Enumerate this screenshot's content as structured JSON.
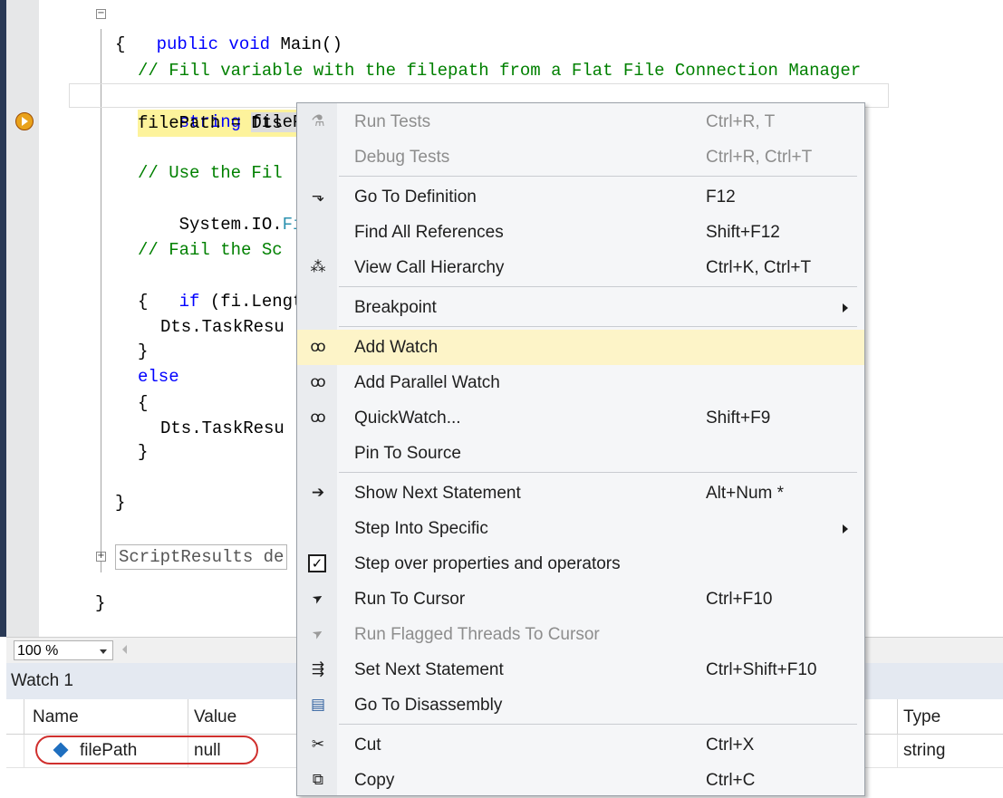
{
  "editor": {
    "lines": [
      {
        "id": "l1",
        "tokens": [
          {
            "t": "public void ",
            "c": "kw"
          },
          {
            "t": "Main()",
            "c": ""
          }
        ]
      },
      {
        "id": "l2",
        "tokens": [
          {
            "t": "{",
            "c": ""
          }
        ]
      },
      {
        "id": "l3",
        "tokens": [
          {
            "t": "// Fill variable with the filepath from a Flat File Connection Manager",
            "c": "cm"
          }
        ]
      },
      {
        "id": "l4",
        "tokens": [
          {
            "t": "string ",
            "c": "kw"
          },
          {
            "t": "filePath",
            "c": "ref"
          },
          {
            "t": ";",
            "c": ""
          }
        ]
      },
      {
        "id": "l5",
        "tokens": [
          {
            "t": "filePath = Dts",
            "c": ""
          }
        ]
      },
      {
        "id": "l6",
        "tokens": [
          {
            "t": "// Use the Fil",
            "c": "cm"
          }
        ]
      },
      {
        "id": "l7",
        "tokens": [
          {
            "t": "System.IO.",
            "c": ""
          },
          {
            "t": "File",
            "c": "tp"
          }
        ]
      },
      {
        "id": "l8",
        "tokens": [
          {
            "t": "// Fail the Sc",
            "c": "cm"
          }
        ]
      },
      {
        "id": "l9",
        "tokens": [
          {
            "t": "if ",
            "c": "kw"
          },
          {
            "t": "(fi.Length",
            "c": ""
          }
        ]
      },
      {
        "id": "l10",
        "tokens": [
          {
            "t": "{",
            "c": ""
          }
        ]
      },
      {
        "id": "l11",
        "tokens": [
          {
            "t": "Dts.TaskResu",
            "c": ""
          }
        ]
      },
      {
        "id": "l12",
        "tokens": [
          {
            "t": "}",
            "c": ""
          }
        ]
      },
      {
        "id": "l13",
        "tokens": [
          {
            "t": "else",
            "c": "kw"
          }
        ]
      },
      {
        "id": "l14",
        "tokens": [
          {
            "t": "{",
            "c": ""
          }
        ]
      },
      {
        "id": "l15",
        "tokens": [
          {
            "t": "Dts.TaskResu",
            "c": ""
          }
        ]
      },
      {
        "id": "l16",
        "tokens": [
          {
            "t": "}",
            "c": ""
          }
        ]
      },
      {
        "id": "l17",
        "tokens": [
          {
            "t": "}",
            "c": ""
          }
        ]
      },
      {
        "id": "l18",
        "tokens": [
          {
            "t": "ScriptResults de",
            "c": ""
          }
        ]
      },
      {
        "id": "l19",
        "tokens": [
          {
            "t": "}",
            "c": ""
          }
        ]
      }
    ],
    "fold_minus": "−",
    "fold_plus": "+"
  },
  "zoom": {
    "value": "100 %"
  },
  "watch": {
    "title": "Watch 1",
    "columns": {
      "name": "Name",
      "value": "Value",
      "type": "Type"
    },
    "rows": [
      {
        "name": "filePath",
        "value": "null",
        "type": "string"
      }
    ]
  },
  "context_menu": {
    "items": [
      {
        "id": "run-tests",
        "label": "Run Tests",
        "shortcut": "Ctrl+R, T",
        "icon": "flask-icon",
        "glyph": "⚗",
        "disabled": true
      },
      {
        "id": "debug-tests",
        "label": "Debug Tests",
        "shortcut": "Ctrl+R, Ctrl+T",
        "icon": "",
        "glyph": "",
        "disabled": true
      },
      {
        "id": "go-to-definition",
        "label": "Go To Definition",
        "shortcut": "F12",
        "icon": "go-to-definition-icon",
        "glyph": "⬎",
        "disabled": false
      },
      {
        "id": "find-all-references",
        "label": "Find All References",
        "shortcut": "Shift+F12",
        "icon": "",
        "glyph": "",
        "disabled": false
      },
      {
        "id": "view-call-hierarchy",
        "label": "View Call Hierarchy",
        "shortcut": "Ctrl+K, Ctrl+T",
        "icon": "call-hierarchy-icon",
        "glyph": "⁂",
        "disabled": false
      },
      {
        "id": "breakpoint",
        "label": "Breakpoint",
        "shortcut": "",
        "icon": "",
        "glyph": "",
        "disabled": false,
        "submenu": true
      },
      {
        "id": "add-watch",
        "label": "Add Watch",
        "shortcut": "",
        "icon": "glasses-icon",
        "glyph": "👓",
        "disabled": false
      },
      {
        "id": "add-parallel-watch",
        "label": "Add Parallel Watch",
        "shortcut": "",
        "icon": "glasses-icon",
        "glyph": "👓",
        "disabled": false
      },
      {
        "id": "quickwatch",
        "label": "QuickWatch...",
        "shortcut": "Shift+F9",
        "icon": "glasses-icon",
        "glyph": "👓",
        "disabled": false
      },
      {
        "id": "pin-to-source",
        "label": "Pin To Source",
        "shortcut": "",
        "icon": "",
        "glyph": "",
        "disabled": false
      },
      {
        "id": "show-next-statement",
        "label": "Show Next Statement",
        "shortcut": "Alt+Num *",
        "icon": "arrow-right-icon",
        "glyph": "➔",
        "disabled": false
      },
      {
        "id": "step-into-specific",
        "label": "Step Into Specific",
        "shortcut": "",
        "icon": "",
        "glyph": "",
        "disabled": false,
        "submenu": true
      },
      {
        "id": "step-over-properties",
        "label": "Step over properties and operators",
        "shortcut": "",
        "icon": "checkbox-icon",
        "glyph": "✓",
        "disabled": false
      },
      {
        "id": "run-to-cursor",
        "label": "Run To Cursor",
        "shortcut": "Ctrl+F10",
        "icon": "cursor-icon",
        "glyph": "➤",
        "disabled": false
      },
      {
        "id": "run-flagged-threads",
        "label": "Run Flagged Threads To Cursor",
        "shortcut": "",
        "icon": "cursor-icon",
        "glyph": "➤",
        "disabled": true
      },
      {
        "id": "set-next-statement",
        "label": "Set Next Statement",
        "shortcut": "Ctrl+Shift+F10",
        "icon": "set-next-statement-icon",
        "glyph": "⇶",
        "disabled": false
      },
      {
        "id": "go-to-disassembly",
        "label": "Go To Disassembly",
        "shortcut": "",
        "icon": "disassembly-icon",
        "glyph": "▤",
        "disabled": false
      },
      {
        "id": "cut",
        "label": "Cut",
        "shortcut": "Ctrl+X",
        "icon": "scissors-icon",
        "glyph": "✂",
        "disabled": false
      },
      {
        "id": "copy",
        "label": "Copy",
        "shortcut": "Ctrl+C",
        "icon": "copy-icon",
        "glyph": "⧉",
        "disabled": false
      }
    ]
  }
}
